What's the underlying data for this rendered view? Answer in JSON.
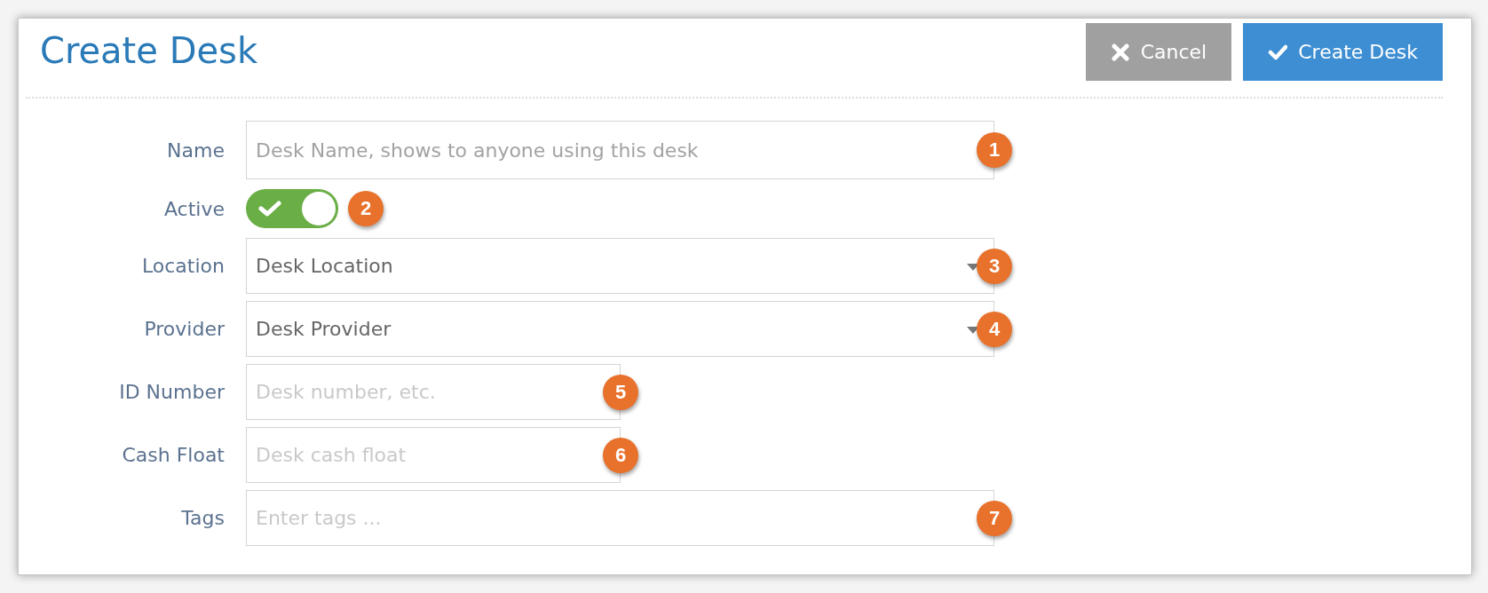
{
  "header": {
    "title": "Create Desk",
    "buttons": [
      {
        "kind": "cancel",
        "label": "Cancel"
      },
      {
        "kind": "confirm",
        "label": "Create Desk"
      }
    ]
  },
  "fields": [
    {
      "label": "Name",
      "kind": "text",
      "placeholder": "Desk Name, shows to anyone using this desk",
      "badge": "1"
    },
    {
      "label": "Active",
      "kind": "toggle",
      "on": true,
      "badge": "2"
    },
    {
      "label": "Location",
      "kind": "select",
      "value": "Desk Location",
      "badge": "3"
    },
    {
      "label": "Provider",
      "kind": "select",
      "value": "Desk Provider",
      "badge": "4"
    },
    {
      "label": "ID Number",
      "kind": "short-text",
      "placeholder": "Desk number, etc.",
      "badge": "5"
    },
    {
      "label": "Cash Float",
      "kind": "short-text",
      "placeholder": "Desk cash float",
      "badge": "6"
    },
    {
      "label": "Tags",
      "kind": "tags",
      "placeholder": "Enter tags ...",
      "badge": "7"
    }
  ]
}
